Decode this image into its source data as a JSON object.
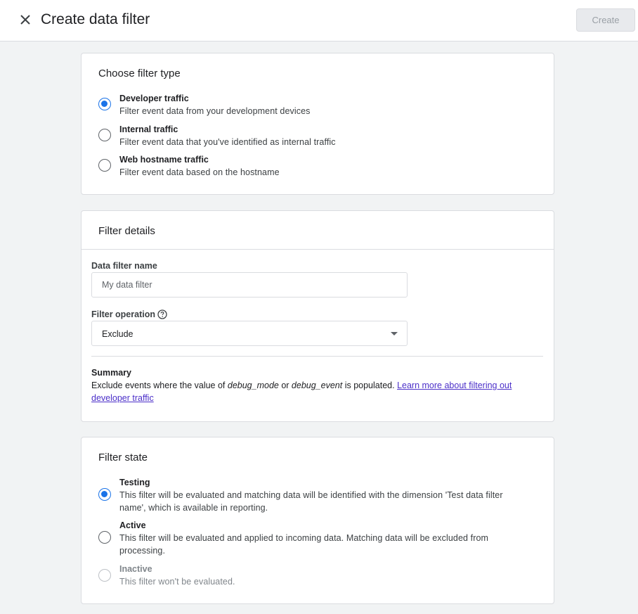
{
  "header": {
    "title": "Create data filter",
    "create_label": "Create",
    "close_icon": "close-icon"
  },
  "filter_type": {
    "title": "Choose filter type",
    "options": [
      {
        "label": "Developer traffic",
        "desc": "Filter event data from your development devices",
        "selected": true
      },
      {
        "label": "Internal traffic",
        "desc": "Filter event data that you've identified as internal traffic",
        "selected": false
      },
      {
        "label": "Web hostname traffic",
        "desc": "Filter event data based on the hostname",
        "selected": false
      }
    ]
  },
  "filter_details": {
    "title": "Filter details",
    "name_label": "Data filter name",
    "name_placeholder": "My data filter",
    "operation_label": "Filter operation",
    "operation_value": "Exclude",
    "summary_title": "Summary",
    "summary_prefix": "Exclude events where the value of ",
    "summary_term1": "debug_mode",
    "summary_or": " or ",
    "summary_term2": "debug_event",
    "summary_suffix": " is populated. ",
    "summary_link": "Learn more about filtering out developer traffic"
  },
  "filter_state": {
    "title": "Filter state",
    "options": [
      {
        "label": "Testing",
        "desc": "This filter will be evaluated and matching data will be identified with the dimension 'Test data filter name', which is available in reporting.",
        "selected": true,
        "disabled": false
      },
      {
        "label": "Active",
        "desc": "This filter will be evaluated and applied to incoming data. Matching data will be excluded from processing.",
        "selected": false,
        "disabled": false
      },
      {
        "label": "Inactive",
        "desc": "This filter won't be evaluated.",
        "selected": false,
        "disabled": true
      }
    ]
  },
  "colors": {
    "accent": "#1a73e8",
    "link": "#4b2fc9",
    "background": "#f1f3f4"
  }
}
